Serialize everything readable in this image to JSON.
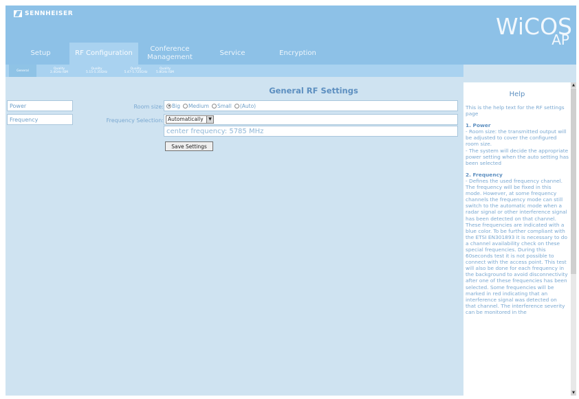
{
  "brand": {
    "logo_text": "SENNHEISER",
    "product": "WiCOS",
    "product_sub": "AP"
  },
  "main_tabs": [
    {
      "label": "Setup"
    },
    {
      "label": "RF Configuration",
      "active": true
    },
    {
      "label": "Conference Management"
    },
    {
      "label": "Service"
    },
    {
      "label": "Encryption"
    }
  ],
  "sub_tabs": [
    {
      "line1": "General",
      "line2": "",
      "active": true
    },
    {
      "line1": "Quality",
      "line2": "2.4GHz ISM"
    },
    {
      "line1": "Quality",
      "line2": "5.15-5.35GHz"
    },
    {
      "line1": "Quality",
      "line2": "5.47-5.725GHz"
    },
    {
      "line1": "Quality",
      "line2": "5.8GHz ISM"
    }
  ],
  "nav": [
    {
      "label": "Power"
    },
    {
      "label": "Frequency"
    }
  ],
  "page_title": "General RF Settings",
  "room_size": {
    "label": "Room size:",
    "options": [
      {
        "label": "Big",
        "selected": true
      },
      {
        "label": "Medium"
      },
      {
        "label": "Small"
      },
      {
        "label": "(Auto)"
      }
    ]
  },
  "frequency_selection": {
    "label": "Frequency Selection:",
    "value": "Automatically"
  },
  "center_frequency": "center frequency: 5785 MHz",
  "save_button": "Save Settings",
  "help": {
    "title": "Help",
    "intro": "This is the help text for the RF settings page",
    "power_head": "1. Power",
    "power_text_1": "- Room size: the transmitted output will be adjusted to cover the configured room size.",
    "power_text_2": "- The system will decide the appropriate power setting when the auto setting has been selected",
    "freq_head": "2. Frequency",
    "freq_text": "- Defines the used frequency channel. The frequency will be fixed in this mode. However, at some frequency channels the frequency mode can still switch to the automatic mode when a radar signal or other interference signal has been detected on that channel. These frequencies are indicated with a blue color. To be further compliant with the ETSI EN301893 it is necessary to do a channel availability check on these special frequencies. During this 60seconds test it is not possible to connect with the access point. This test will also be done for each frequency in the background to avoid disconnectivity after one of these frequencies has been selected. Some frequencies will be marked in red indicating that an interference signal was detected on that channel. The interference severity can be monitored in the"
  },
  "colors": {
    "header": "#8dc1e7",
    "background": "#cfe3f1",
    "text_blue": "#6d9fc9"
  }
}
